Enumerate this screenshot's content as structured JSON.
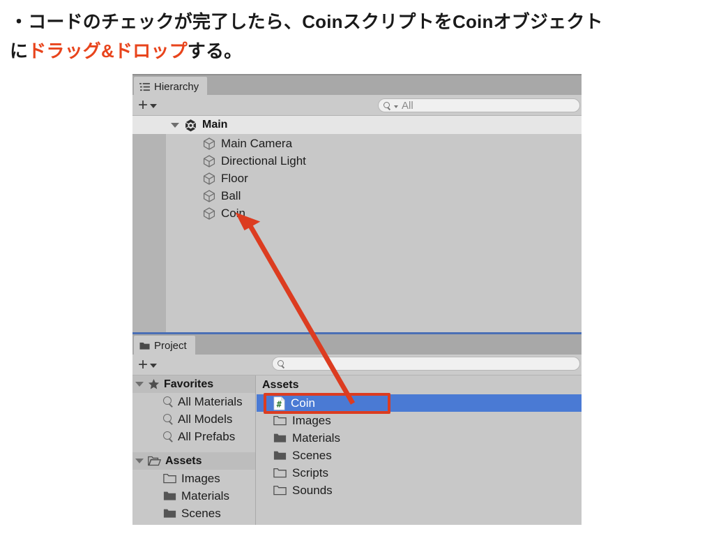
{
  "caption": {
    "line1_pre": "・コードのチェックが完了したら、Coinスクリプトを",
    "line1_post": "Coinオブジェクト",
    "line2_pre": "に",
    "line2_highlight": "ドラッグ&ドロップ",
    "line2_post": "する。",
    "highlight_color": "#e8441c"
  },
  "hierarchy": {
    "tab_label": "Hierarchy",
    "tab_icon": "hierarchy-list-icon",
    "create_button_label": "+",
    "search": {
      "value": "",
      "placeholder": "All",
      "icon": "search-dropdown-icon"
    },
    "root": {
      "label": "Main",
      "icon": "unity-scene-icon",
      "expanded": true
    },
    "items": [
      {
        "label": "Main Camera",
        "icon": "gameobject-cube-icon"
      },
      {
        "label": "Directional Light",
        "icon": "gameobject-cube-icon"
      },
      {
        "label": "Floor",
        "icon": "gameobject-cube-icon"
      },
      {
        "label": "Ball",
        "icon": "gameobject-cube-icon"
      },
      {
        "label": "Coin",
        "icon": "gameobject-cube-icon"
      }
    ]
  },
  "project": {
    "tab_label": "Project",
    "tab_icon": "folder-icon",
    "create_button_label": "+",
    "search": {
      "value": "",
      "placeholder": "",
      "icon": "search-icon"
    },
    "sidebar": {
      "favorites": {
        "label": "Favorites",
        "icon": "star-icon",
        "expanded": true,
        "items": [
          {
            "label": "All Materials",
            "icon": "saved-search-icon"
          },
          {
            "label": "All Models",
            "icon": "saved-search-icon"
          },
          {
            "label": "All Prefabs",
            "icon": "saved-search-icon"
          }
        ]
      },
      "assets": {
        "label": "Assets",
        "icon": "open-folder-icon",
        "expanded": true,
        "items": [
          {
            "label": "Images",
            "icon": "folder-outline-icon"
          },
          {
            "label": "Materials",
            "icon": "folder-filled-icon"
          },
          {
            "label": "Scenes",
            "icon": "folder-filled-icon"
          }
        ]
      }
    },
    "content": {
      "title": "Assets",
      "items": [
        {
          "label": "Coin",
          "icon": "csharp-script-icon",
          "selected": true
        },
        {
          "label": "Images",
          "icon": "folder-outline-icon",
          "selected": false
        },
        {
          "label": "Materials",
          "icon": "folder-filled-icon",
          "selected": false
        },
        {
          "label": "Scenes",
          "icon": "folder-filled-icon",
          "selected": false
        },
        {
          "label": "Scripts",
          "icon": "folder-outline-icon",
          "selected": false
        },
        {
          "label": "Sounds",
          "icon": "folder-outline-icon",
          "selected": false
        }
      ]
    }
  },
  "annotations": {
    "highlight_box_target": "Coin",
    "arrow_from": "project-asset-coin",
    "arrow_to": "hierarchy-item-coin",
    "color": "#dc3c20",
    "selection_color": "#4a7ad4"
  }
}
